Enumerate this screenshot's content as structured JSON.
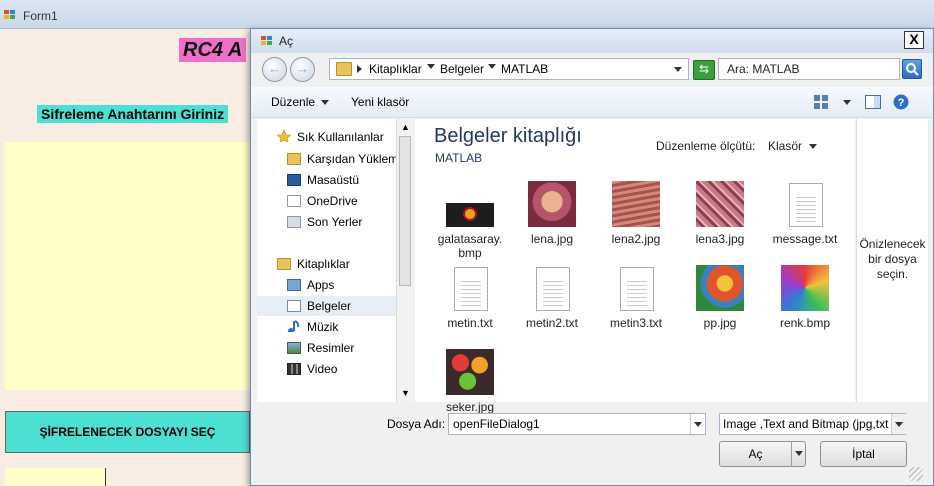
{
  "form": {
    "title": "Form1",
    "rc4_title": "RC4 A",
    "key_label": "Sifreleme Anahtarını Giriniz",
    "encrypt_button": "ŞİFRELENECEK DOSYAYI SEÇ"
  },
  "dialog": {
    "title": "Aç",
    "close_label": "X",
    "nav": {
      "back_glyph": "←",
      "forward_glyph": "→",
      "refresh_glyph": "⇆"
    },
    "breadcrumb": [
      "Kitaplıklar",
      "Belgeler",
      "MATLAB"
    ],
    "search_placeholder": "Ara: MATLAB",
    "toolbar": {
      "organize": "Düzenle",
      "new_folder": "Yeni klasör"
    },
    "sidebar": {
      "favorites_header": "Sık Kullanılanlar",
      "favorites": [
        "Karşıdan Yüklem",
        "Masaüstü",
        "OneDrive",
        "Son Yerler"
      ],
      "libraries_header": "Kitaplıklar",
      "libraries": [
        "Apps",
        "Belgeler",
        "Müzik",
        "Resimler",
        "Video"
      ],
      "selected": "Belgeler"
    },
    "content": {
      "library_title": "Belgeler kitaplığı",
      "library_subtitle": "MATLAB",
      "arrange_label": "Düzenleme ölçütü:",
      "arrange_value": "Klasör",
      "files": [
        {
          "name": "galatasaray.\nbmp",
          "kind": "image"
        },
        {
          "name": "lena.jpg",
          "kind": "image"
        },
        {
          "name": "lena2.jpg",
          "kind": "image"
        },
        {
          "name": "lena3.jpg",
          "kind": "image"
        },
        {
          "name": "message.txt",
          "kind": "text"
        },
        {
          "name": "metin.txt",
          "kind": "text"
        },
        {
          "name": "metin2.txt",
          "kind": "text"
        },
        {
          "name": "metin3.txt",
          "kind": "text"
        },
        {
          "name": "pp.jpg",
          "kind": "image"
        },
        {
          "name": "renk.bmp",
          "kind": "image"
        },
        {
          "name": "seker.jpg",
          "kind": "image"
        }
      ]
    },
    "preview_text": "Önizlenecek bir dosya seçin.",
    "filename_label": "Dosya Adı:",
    "filename_value": "openFileDialog1",
    "filter_value": "Image ,Text and Bitmap (jpg,txt",
    "open_button": "Aç",
    "cancel_button": "İptal"
  }
}
